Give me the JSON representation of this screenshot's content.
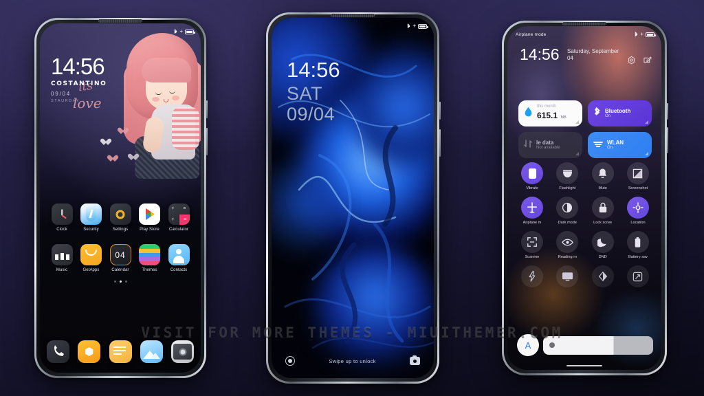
{
  "scene": {
    "watermark": "VISIT FOR MORE THEMES - MIUITHEMER.COM",
    "background_colors": {
      "top": "#3b3566",
      "bottom": "#0a0915"
    }
  },
  "phone1": {
    "name": "home-screen-phone",
    "statusbar": {
      "left_text": "",
      "bluetooth_icon": "bluetooth-icon",
      "charging_icon": "charging-icon",
      "battery_icon": "battery-icon"
    },
    "lockwidget": {
      "time": "14:56",
      "owner": "COSTANTINO",
      "date": "09/04",
      "weekday": "STAURDAY",
      "scribble1": "its",
      "scribble2": "love"
    },
    "apps_row1": [
      {
        "label": "Clock",
        "icon": "clock-icon"
      },
      {
        "label": "Security",
        "icon": "security-shield-icon"
      },
      {
        "label": "Settings",
        "icon": "settings-gear-icon"
      },
      {
        "label": "Play Store",
        "icon": "play-store-icon"
      },
      {
        "label": "Calculator",
        "icon": "calculator-icon"
      }
    ],
    "apps_row2": [
      {
        "label": "Music",
        "icon": "music-icon"
      },
      {
        "label": "GetApps",
        "icon": "getapps-icon"
      },
      {
        "label": "Calendar",
        "icon": "calendar-icon",
        "day": "04"
      },
      {
        "label": "Themes",
        "icon": "themes-icon"
      },
      {
        "label": "Contacts",
        "icon": "contacts-icon"
      }
    ],
    "page_dots": {
      "count": 3,
      "active_index": 1
    },
    "dock": [
      {
        "label": "Phone",
        "icon": "phone-dialer-icon"
      },
      {
        "label": "Browser",
        "icon": "browser-icon"
      },
      {
        "label": "Notes",
        "icon": "notes-icon"
      },
      {
        "label": "Gallery",
        "icon": "gallery-icon"
      },
      {
        "label": "Camera",
        "icon": "camera-icon"
      }
    ]
  },
  "phone2": {
    "name": "lock-screen-phone",
    "statusbar": {
      "bluetooth_icon": "bluetooth-icon",
      "charging_icon": "charging-icon",
      "battery_icon": "battery-icon"
    },
    "clock": {
      "time": "14:56",
      "weekday": "SAT",
      "date": "09/04"
    },
    "footer": {
      "hint": "Swipe up to unlock",
      "left_icon": "flashlight-circle-icon",
      "right_icon": "camera-icon"
    }
  },
  "phone3": {
    "name": "quick-settings-phone",
    "statusbar": {
      "left_text": "Airplane mode",
      "bluetooth_icon": "bluetooth-icon",
      "charging_icon": "charging-icon",
      "battery_icon": "battery-icon"
    },
    "header": {
      "time": "14:56",
      "date": "Saturday, September 04",
      "settings_icon": "settings-gear-icon",
      "edit_icon": "edit-pencil-icon"
    },
    "cards": [
      {
        "style": "light",
        "icon": "data-drop-icon",
        "top": "this month",
        "value": "615.1",
        "unit": "MB"
      },
      {
        "style": "bluetooth",
        "icon": "bluetooth-icon",
        "title": "Bluetooth",
        "sub": "On"
      },
      {
        "style": "dim",
        "icon": "mobile-data-icon",
        "title": "le data",
        "sub": "Not available"
      },
      {
        "style": "wlan",
        "icon": "wlan-icon",
        "title": "WLAN",
        "sub": "On"
      }
    ],
    "toggles": [
      {
        "label": "Vibrate",
        "icon": "vibrate-icon",
        "state": "on"
      },
      {
        "label": "Flashlight",
        "icon": "flashlight-icon",
        "state": "off"
      },
      {
        "label": "Mute",
        "icon": "bell-mute-icon",
        "state": "off"
      },
      {
        "label": "Screenshot",
        "icon": "screenshot-icon",
        "state": "off"
      },
      {
        "label": "Airplane m",
        "icon": "airplane-icon",
        "state": "on"
      },
      {
        "label": "Dark mode",
        "icon": "dark-mode-icon",
        "state": "off"
      },
      {
        "label": "Lock scree",
        "icon": "lock-icon",
        "state": "off"
      },
      {
        "label": "Location",
        "icon": "location-icon",
        "state": "on"
      },
      {
        "label": "Scanner",
        "icon": "scanner-icon",
        "state": "off"
      },
      {
        "label": "Reading m",
        "icon": "reading-mode-eye-icon",
        "state": "off"
      },
      {
        "label": "DND",
        "icon": "moon-icon",
        "state": "off"
      },
      {
        "label": "Battery sav",
        "icon": "battery-saver-icon",
        "state": "off"
      },
      {
        "label": "",
        "icon": "lightning-icon",
        "state": "dark"
      },
      {
        "label": "",
        "icon": "cast-screen-icon",
        "state": "dark"
      },
      {
        "label": "",
        "icon": "color-mode-icon",
        "state": "dark"
      },
      {
        "label": "",
        "icon": "screen-rotate-icon",
        "state": "dark"
      }
    ],
    "brightness": {
      "auto_label": "A",
      "level_percent": 64
    }
  }
}
